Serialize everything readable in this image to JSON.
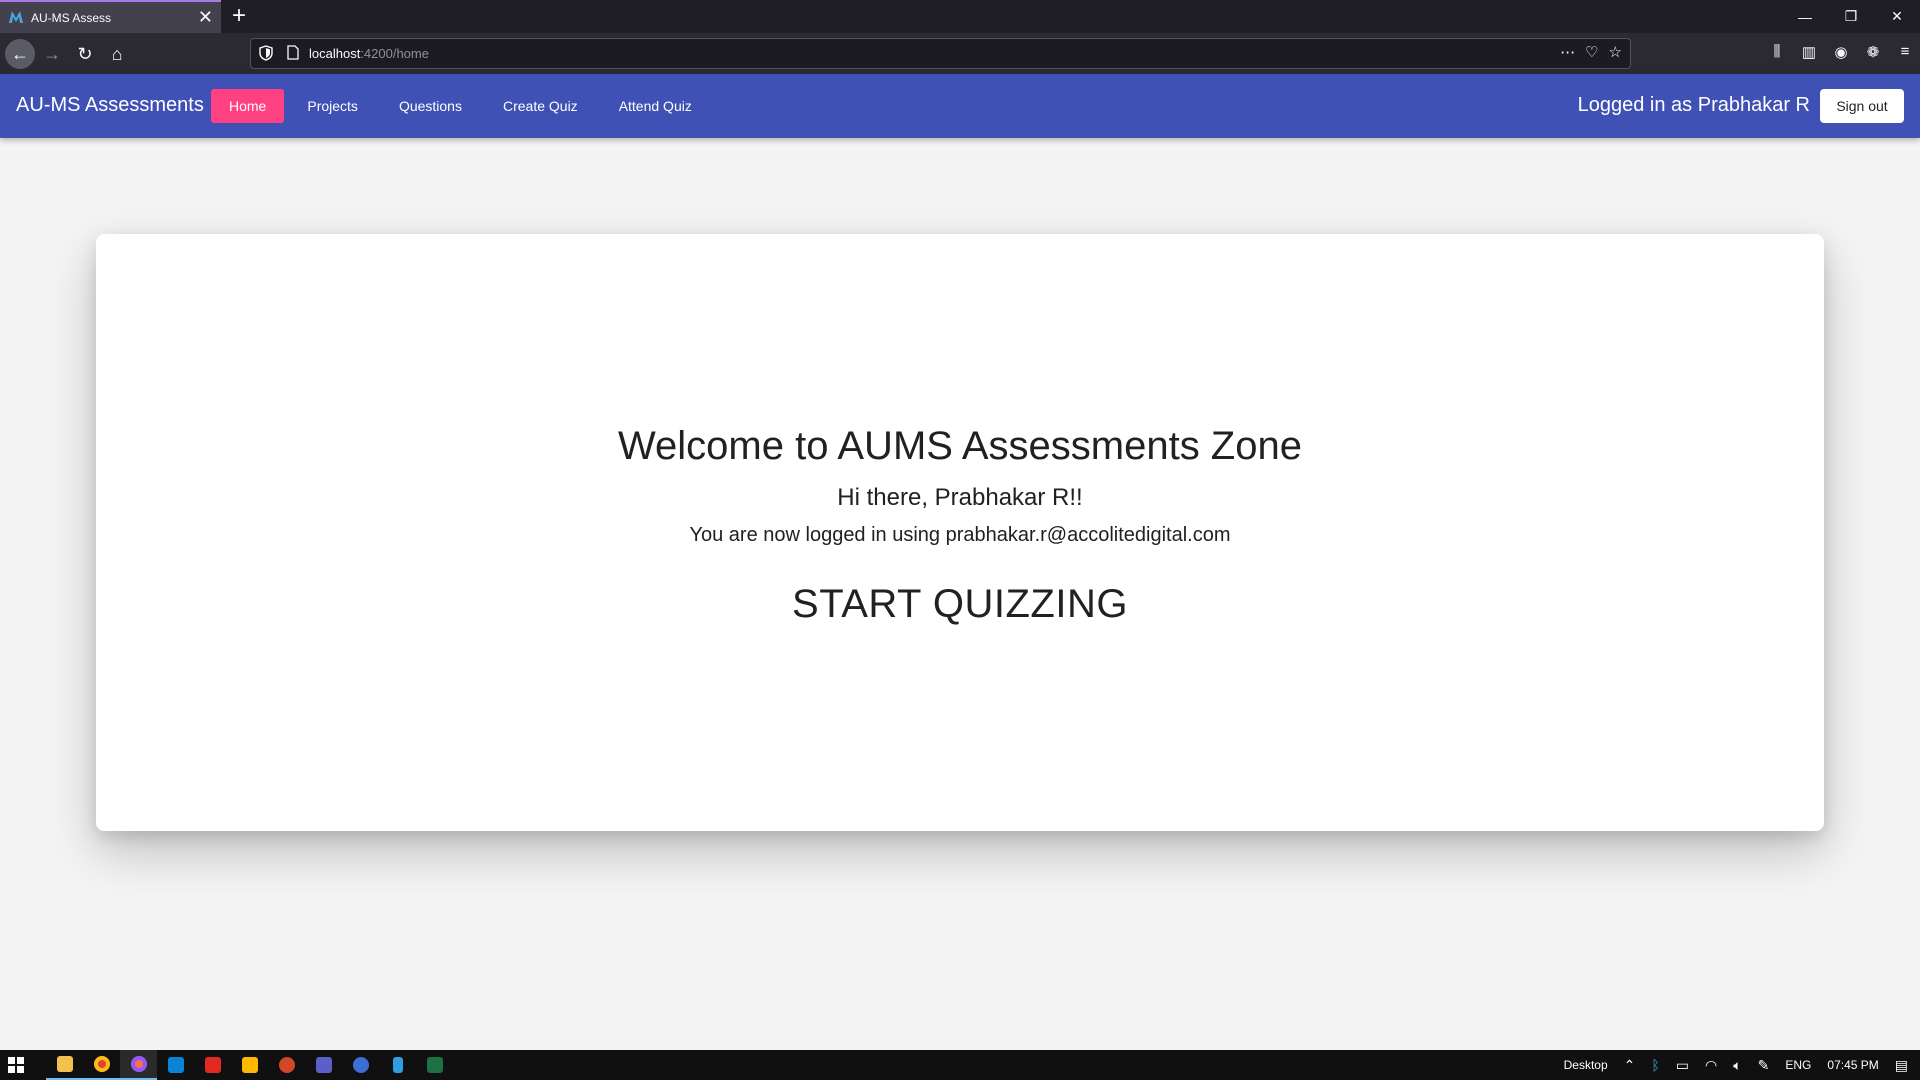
{
  "browser": {
    "tab_title": "AU-MS Assess",
    "tab_close": "✕",
    "new_tab": "+",
    "url_host": "localhost",
    "url_path": ":4200/home",
    "window_controls": [
      "—",
      "❐",
      "✕"
    ]
  },
  "app": {
    "brand": "AU-MS Assessments",
    "menu": [
      {
        "label": "Home",
        "active": true
      },
      {
        "label": "Projects"
      },
      {
        "label": "Questions"
      },
      {
        "label": "Create Quiz"
      },
      {
        "label": "Attend Quiz"
      }
    ],
    "logged_in_as": "Logged in as Prabhakar R",
    "sign_out": "Sign out",
    "accent_color": "#3f51b5",
    "active_color": "#ff4081"
  },
  "main": {
    "welcome": "Welcome to AUMS Assessments Zone",
    "greeting": "Hi there, Prabhakar R!!",
    "logged_using": "You are now logged in using prabhakar.r@accolitedigital.com",
    "start": "START QUIZZING"
  },
  "taskbar": {
    "desktop_label": "Desktop",
    "language": "ENG",
    "time": "07:45 PM",
    "apps": [
      "file-explorer",
      "chrome",
      "firefox",
      "vscode",
      "acrobat",
      "files",
      "powerpoint",
      "teams",
      "webex",
      "notepad",
      "excel"
    ]
  }
}
